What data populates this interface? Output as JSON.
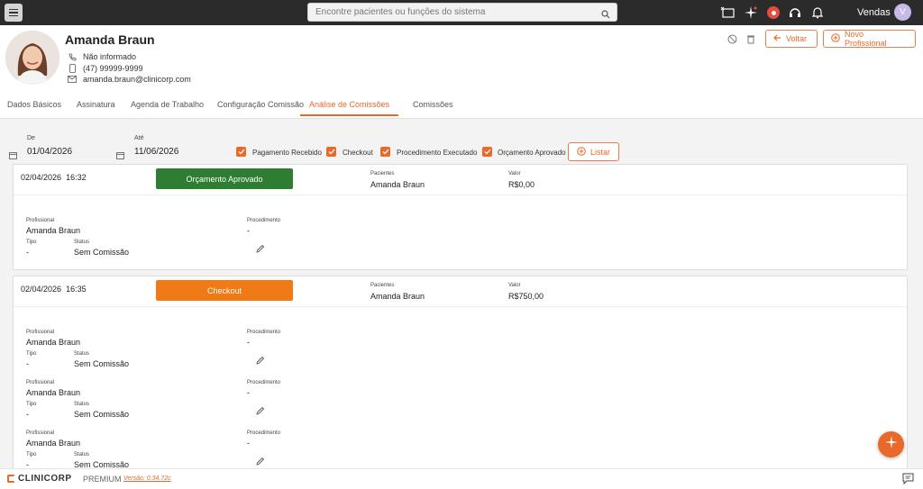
{
  "topbar": {
    "search_placeholder": "Encontre pacientes ou funções do sistema",
    "user_label": "Vendas",
    "avatar_initial": "V"
  },
  "profile": {
    "name": "Amanda Braun",
    "phone_fixed": "Não informado",
    "phone_mobile": "(47) 99999-9999",
    "email": "amanda.braun@clinicorp.com"
  },
  "header_buttons": {
    "back": "Voltar",
    "new_professional": "Novo Profissional"
  },
  "tabs": [
    {
      "label": "Dados Básicos"
    },
    {
      "label": "Assinatura"
    },
    {
      "label": "Agenda de Trabalho"
    },
    {
      "label": "Configuração Comissão"
    },
    {
      "label": "Análise de Comissões",
      "active": true
    },
    {
      "label": "Comissões"
    }
  ],
  "filters": {
    "from_label": "De",
    "from_value": "01/04/2026",
    "to_label": "Até",
    "to_value": "11/06/2026",
    "checkboxes": [
      {
        "label": "Pagamento Recebido",
        "checked": true
      },
      {
        "label": "Checkout",
        "checked": true
      },
      {
        "label": "Procedimento Executado",
        "checked": true
      },
      {
        "label": "Orçamento Aprovado",
        "checked": true
      }
    ],
    "list_button": "Listar"
  },
  "labels": {
    "paciente": "Pacientes",
    "valor": "Valor",
    "profissional": "Profissional",
    "procedimento": "Procedimento",
    "tipo": "Tipo",
    "status": "Status"
  },
  "cards": [
    {
      "date": "02/04/2026",
      "time": "16:32",
      "status": "Orçamento Aprovado",
      "status_color": "#2e7d32",
      "patient": "Amanda Braun",
      "value": "R$0,00",
      "entries": [
        {
          "professional": "Amanda Braun",
          "procedure": "-",
          "type": "-",
          "status": "Sem Comissão"
        }
      ]
    },
    {
      "date": "02/04/2026",
      "time": "16:35",
      "status": "Checkout",
      "status_color": "#f07a16",
      "patient": "Amanda Braun",
      "value": "R$750,00",
      "entries": [
        {
          "professional": "Amanda Braun",
          "procedure": "-",
          "type": "-",
          "status": "Sem Comissão"
        },
        {
          "professional": "Amanda Braun",
          "procedure": "-",
          "type": "-",
          "status": "Sem Comissão"
        },
        {
          "professional": "Amanda Braun",
          "procedure": "-",
          "type": "-",
          "status": "Sem Comissão"
        }
      ]
    }
  ],
  "footer": {
    "logo": "CLINICORP",
    "plan": "PREMIUM",
    "version": "Versão: 0.34.72c"
  },
  "colors": {
    "accent": "#e8692a",
    "topbar": "#2b2b2b"
  }
}
